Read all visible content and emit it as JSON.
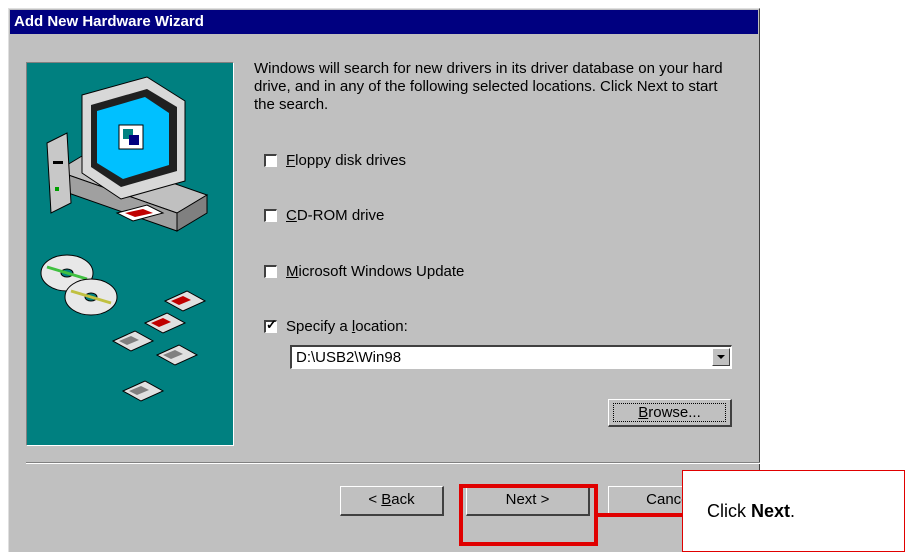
{
  "window": {
    "title": "Add New Hardware Wizard"
  },
  "intro": "Windows will search for new drivers in its driver database on your hard drive, and in any of the following selected locations. Click Next to start the search.",
  "options": [
    {
      "label_ul": "F",
      "label_rest": "loppy disk drives",
      "checked": false
    },
    {
      "label_ul": "C",
      "label_rest": "D-ROM drive",
      "checked": false
    },
    {
      "label_ul": "M",
      "label_rest": "icrosoft Windows Update",
      "checked": false
    },
    {
      "label_pre": "Specify a ",
      "label_ul": "l",
      "label_rest": "ocation:",
      "checked": true
    }
  ],
  "location_value": "D:\\USB2\\Win98",
  "buttons": {
    "browse_ul": "B",
    "browse_rest": "rowse...",
    "back_pre": "< ",
    "back_ul": "B",
    "back_rest": "ack",
    "next": "Next >",
    "cancel": "Cancel"
  },
  "callout": {
    "pre": "Click ",
    "bold": "Next",
    "post": "."
  },
  "colors": {
    "titlebar": "#000080",
    "art_bg": "#008080",
    "highlight": "#e00000",
    "face": "#c0c0c0"
  },
  "icons": [
    "computer-illustration-icon",
    "cd-disc-icon",
    "floppy-disk-icon",
    "checkmark-icon",
    "dropdown-arrow-icon"
  ]
}
